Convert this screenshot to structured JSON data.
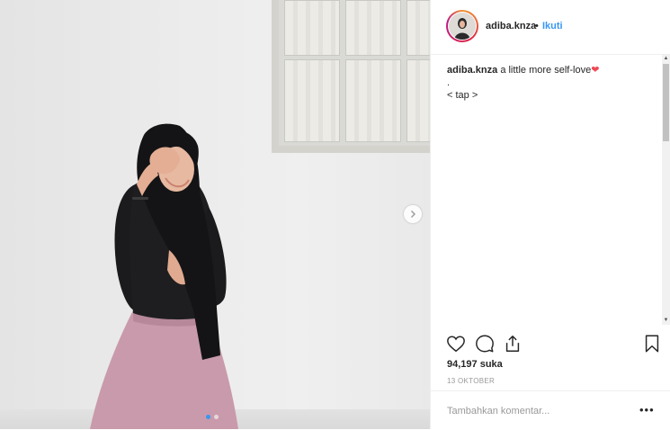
{
  "post": {
    "username": "adiba.knza",
    "separator": "•",
    "follow_label": "Ikuti",
    "caption_text": "a little more self-love",
    "caption_emoji": "❤",
    "caption_line2": ".",
    "caption_line3": "< tap >",
    "likes": "94,197 suka",
    "date": "13 OKTOBER",
    "comment_placeholder": "Tambahkan komentar...",
    "more_label": "•••"
  },
  "carousel": {
    "slides": 2,
    "current": 1
  },
  "colors": {
    "accent": "#3897f0",
    "heart": "#ed4956",
    "skirt": "#c99aab"
  },
  "icons": [
    "heart-icon",
    "comment-icon",
    "share-icon",
    "bookmark-icon",
    "chevron-right-icon"
  ]
}
